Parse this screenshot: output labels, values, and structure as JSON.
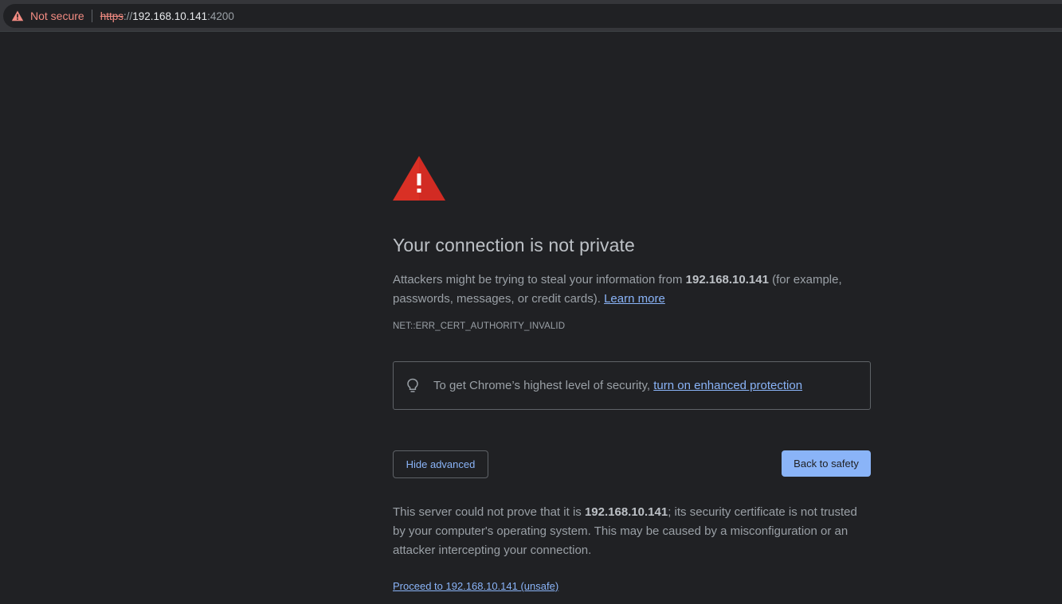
{
  "address_bar": {
    "security_label": "Not secure",
    "scheme": "https",
    "scheme_sep": "://",
    "host": "192.168.10.141",
    "port": ":4200",
    "security_color": "#f28b82"
  },
  "interstitial": {
    "icon": "red-warning-triangle-icon",
    "heading": "Your connection is not private",
    "explain_pre": "Attackers might be trying to steal your information from ",
    "explain_host": "192.168.10.141",
    "explain_post": " (for example, passwords, messages, or credit cards). ",
    "learn_more": "Learn more",
    "error_code": "NET::ERR_CERT_AUTHORITY_INVALID",
    "enhanced_pre": "To get Chrome’s highest level of security, ",
    "enhanced_link": "turn on enhanced protection",
    "hide_advanced": "Hide advanced",
    "back_to_safety": "Back to safety",
    "details_pre": "This server could not prove that it is ",
    "details_host": "192.168.10.141",
    "details_post": "; its security certificate is not trusted by your computer's operating system. This may be caused by a misconfiguration or an attacker intercepting your connection.",
    "proceed": "Proceed to 192.168.10.141 (unsafe)"
  },
  "colors": {
    "background": "#202124",
    "accent": "#8ab4f8",
    "warning_red": "#d93025"
  }
}
